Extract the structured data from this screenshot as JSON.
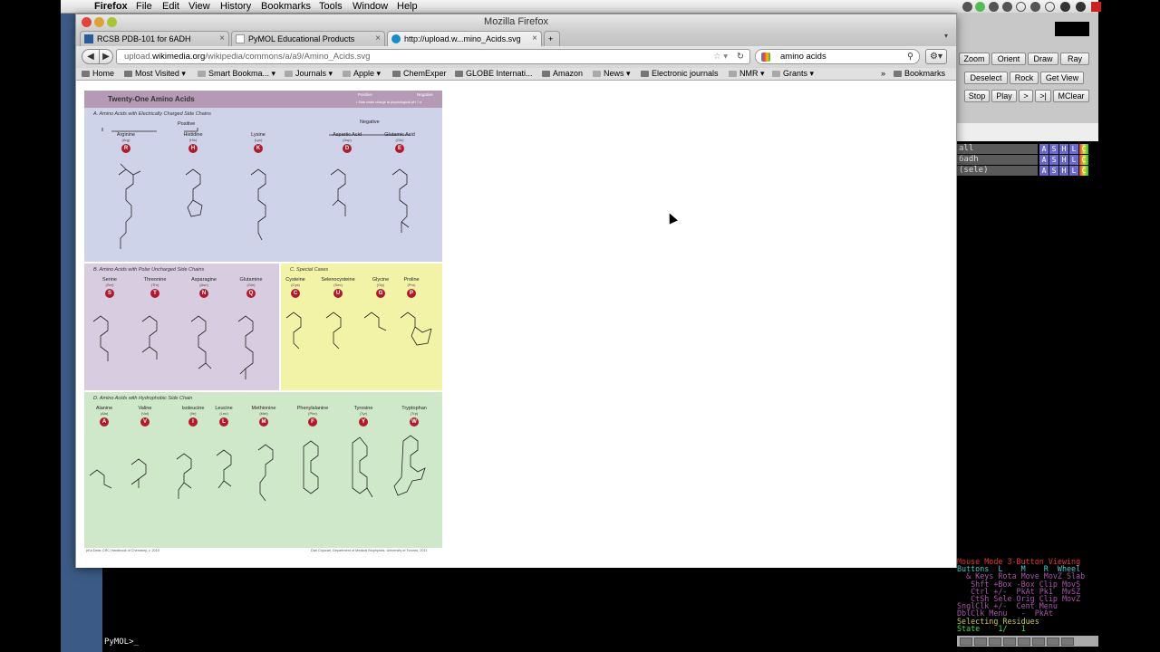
{
  "menubar": {
    "app": "Firefox",
    "items": [
      "File",
      "Edit",
      "View",
      "History",
      "Bookmarks",
      "Tools",
      "Window",
      "Help"
    ]
  },
  "firefox": {
    "window_title": "Mozilla Firefox",
    "tabs": [
      {
        "label": "RCSB PDB-101 for 6ADH",
        "active": false
      },
      {
        "label": "PyMOL Educational Products",
        "active": false
      },
      {
        "label": "http://upload.w...mino_Acids.svg",
        "active": true
      }
    ],
    "url_plain": "upload.",
    "url_domain": "wikimedia.org",
    "url_path": "/wikipedia/commons/a/a9/Amino_Acids.svg",
    "search_value": "amino acids",
    "bookmarks": [
      {
        "label": "Home",
        "folder": false
      },
      {
        "label": "Most Visited ▾",
        "folder": false
      },
      {
        "label": "Smart Bookma... ▾",
        "folder": true
      },
      {
        "label": "Journals ▾",
        "folder": true
      },
      {
        "label": "Apple ▾",
        "folder": true
      },
      {
        "label": "ChemExper",
        "folder": false
      },
      {
        "label": "GLOBE Internati...",
        "folder": false
      },
      {
        "label": "Amazon",
        "folder": false
      },
      {
        "label": "News ▾",
        "folder": true
      },
      {
        "label": "Electronic journals",
        "folder": false
      },
      {
        "label": "NMR ▾",
        "folder": true
      },
      {
        "label": "Grants ▾",
        "folder": true
      }
    ],
    "bookmarks_menu": "Bookmarks"
  },
  "poster": {
    "title": "Twenty-One Amino Acids",
    "legend_positive": "Positive",
    "legend_negative": "Negative",
    "legend_note": "• Side chain charge at physiological pH 7.4",
    "panel_a": {
      "title": "A.   Amino Acids with Electrically Charged Side Chains",
      "positive": "Positive",
      "negative": "Negative",
      "acids": [
        {
          "name": "Arginine",
          "abbr": "(Arg)",
          "letter": "R"
        },
        {
          "name": "Histidine",
          "abbr": "(His)",
          "letter": "H"
        },
        {
          "name": "Lysine",
          "abbr": "(Lys)",
          "letter": "K"
        },
        {
          "name": "Aspartic Acid",
          "abbr": "(Asp)",
          "letter": "D"
        },
        {
          "name": "Glutamic Acid",
          "abbr": "(Glu)",
          "letter": "E"
        }
      ]
    },
    "panel_b": {
      "title": "B.   Amino Acids with Polar Uncharged Side Chains",
      "acids": [
        {
          "name": "Serine",
          "abbr": "(Ser)",
          "letter": "S"
        },
        {
          "name": "Threonine",
          "abbr": "(Thr)",
          "letter": "T"
        },
        {
          "name": "Asparagine",
          "abbr": "(Asn)",
          "letter": "N"
        },
        {
          "name": "Glutamine",
          "abbr": "(Gln)",
          "letter": "Q"
        }
      ]
    },
    "panel_c": {
      "title": "C.   Special Cases",
      "acids": [
        {
          "name": "Cysteine",
          "abbr": "(Cys)",
          "letter": "C"
        },
        {
          "name": "Selenocysteine",
          "abbr": "(Sec)",
          "letter": "U"
        },
        {
          "name": "Glycine",
          "abbr": "(Gly)",
          "letter": "G"
        },
        {
          "name": "Proline",
          "abbr": "(Pro)",
          "letter": "P"
        }
      ]
    },
    "panel_d": {
      "title": "D.   Amino Acids with Hydrophobic Side Chain",
      "acids": [
        {
          "name": "Alanine",
          "abbr": "(Ala)",
          "letter": "A"
        },
        {
          "name": "Valine",
          "abbr": "(Val)",
          "letter": "V"
        },
        {
          "name": "Isoleucine",
          "abbr": "(Ile)",
          "letter": "I"
        },
        {
          "name": "Leucine",
          "abbr": "(Leu)",
          "letter": "L"
        },
        {
          "name": "Methionine",
          "abbr": "(Met)",
          "letter": "M"
        },
        {
          "name": "Phenylalanine",
          "abbr": "(Phe)",
          "letter": "F"
        },
        {
          "name": "Tyrosine",
          "abbr": "(Tyr)",
          "letter": "Y"
        },
        {
          "name": "Tryptophan",
          "abbr": "(Trp)",
          "letter": "W"
        }
      ]
    },
    "footer_left": "pKa Data: CRC Handbook of Chemistry, v. 2010",
    "footer_right": "Dan Cojocari, Department of Medical Biophysics, University of Toronto, 2011",
    "colors": {
      "panel_a": "#cfd3ea",
      "panel_b": "#d8cde0",
      "panel_c": "#f3f3a8",
      "panel_d": "#cfe8c9",
      "header": "#b59ab6",
      "letter": "#b11a2b"
    }
  },
  "pymol": {
    "buttons_row1": [
      "Zoom",
      "Orient",
      "Draw",
      "Ray"
    ],
    "buttons_row2": [
      "Deselect",
      "Rock",
      "Get View"
    ],
    "buttons_row3": [
      "Stop",
      "Play",
      ">",
      ">|",
      "MClear"
    ],
    "objects": [
      {
        "name": "all"
      },
      {
        "name": "6adh"
      },
      {
        "name": "(sele)"
      }
    ],
    "object_buttons": [
      "A",
      "S",
      "H",
      "L",
      "C"
    ],
    "mouse_mode": "Mouse Mode 3-Button Viewing",
    "mouse_header": "Buttons  L    M    R  Wheel",
    "mouse_rows": [
      "  & Keys Rota Move MovZ Slab",
      "   Shft +Box -Box Clip MovS",
      "   Ctrl +/-  PkAt Pk1  MvSZ",
      "   CtSh Sele Orig Clip MovZ",
      "SnglClk +/-  Cent Menu",
      "DblClk Menu   -  PkAt"
    ],
    "selecting": "Selecting Residues",
    "state": "State    1/   1",
    "prompt": "PyMOL>_"
  }
}
